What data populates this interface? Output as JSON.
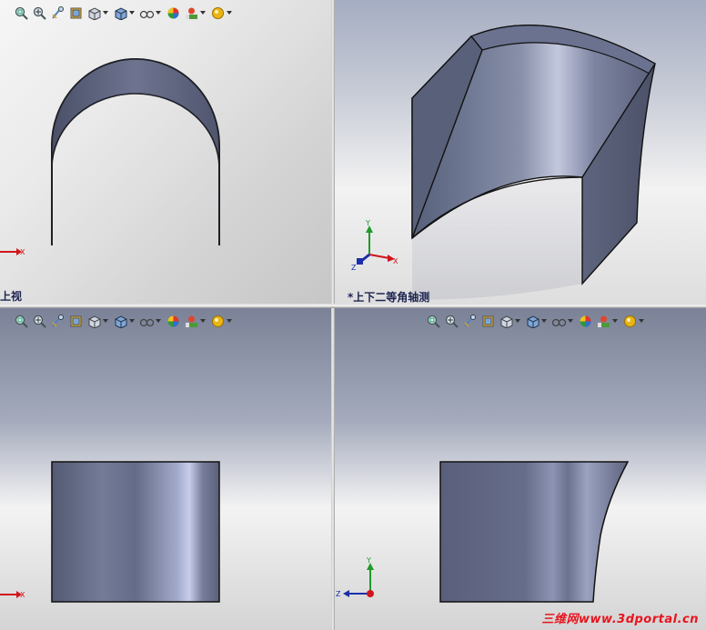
{
  "viewports": {
    "top_left": {
      "view_label": "上视"
    },
    "top_right": {
      "view_label": "*上下二等角轴测"
    }
  },
  "toolbar_icons": [
    "zoom-to-fit-icon",
    "zoom-to-area-icon",
    "previous-view-icon",
    "section-view-icon",
    "view-orientation-icon",
    "display-style-icon",
    "hide-show-items-icon",
    "edit-appearance-icon",
    "apply-scene-icon",
    "view-settings-icon"
  ],
  "triad_labels": {
    "x": "X",
    "y": "Y",
    "z": "Z"
  },
  "colors": {
    "axis_x": "#d0161b",
    "axis_y": "#1f9a2a",
    "axis_z": "#1a2fa8",
    "part": "#6d7286",
    "edge": "#111111"
  },
  "watermark": "三维网www.3dportal.cn"
}
